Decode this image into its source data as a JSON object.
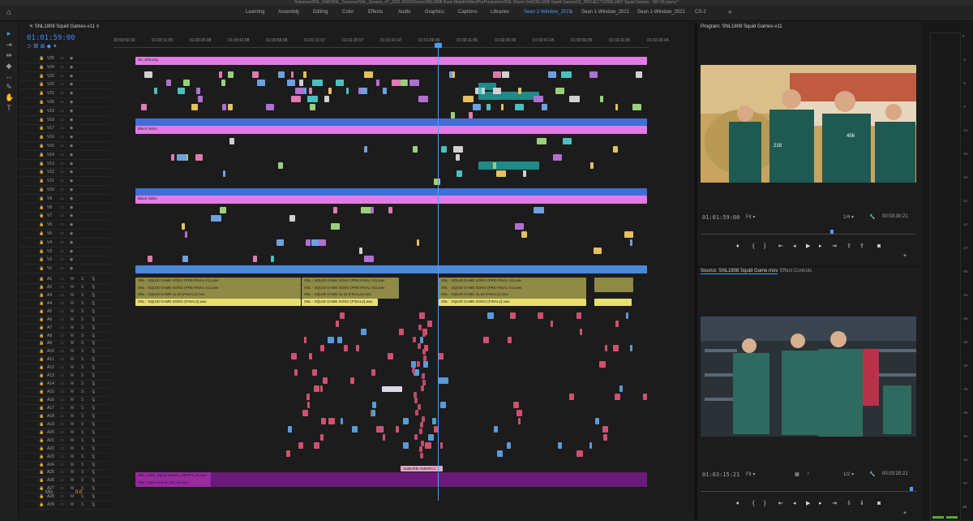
{
  "titlebar": "/Volumes/SNL_SAN/SNL_Seasons/SNL_Season_47_2021-2022/Shows/SNL1808 Rami Malek/Video/PreProduction/SNL Shoot Unit/SNL1808 Squid Games/01_PROJECTS/SNL1807 Squid Games - SM V6.prproj *",
  "workspaces": [
    "Learning",
    "Assembly",
    "Editing",
    "Color",
    "Effects",
    "Audio",
    "Graphics",
    "Captions",
    "Libraries",
    "Sean 2-Window_2021",
    "Sean 1-Window_2021",
    "Sean 1-Window_2021",
    "CS-2"
  ],
  "workspace_active": "Sean 2-Window_2021",
  "sequence": {
    "name": "SNL1808 Squid Games-v11",
    "timecode": "01:01:59:00"
  },
  "ruler": [
    "00:59:56:09",
    "01:00:11:09",
    "01:00:26:08",
    "01:00:41:08",
    "01:00:56:08",
    "01:01:11:07",
    "01:01:26:07",
    "01:01:41:07",
    "01:01:56:06",
    "01:02:11:06",
    "01:02:26:06",
    "01:02:41:05",
    "01:02:56:05",
    "01:03:11:05",
    "01:03:26:04"
  ],
  "video_tracks": [
    "V25",
    "V24",
    "V23",
    "V22",
    "V21",
    "V20",
    "V19",
    "V18",
    "V17",
    "V16",
    "V15",
    "V14",
    "V13",
    "V12",
    "V11",
    "V10",
    "V9",
    "V8",
    "V7",
    "V6",
    "V5",
    "V4",
    "V3",
    "V2",
    "V1"
  ],
  "audio_tracks": [
    "A1",
    "A2",
    "A3",
    "A4",
    "A5",
    "A6",
    "A7",
    "A8",
    "A9",
    "A10",
    "A11",
    "A12",
    "A13",
    "A14",
    "A15",
    "A16",
    "A17",
    "A18",
    "A19",
    "A20",
    "A21",
    "A22",
    "A23",
    "A24",
    "A25",
    "A26",
    "A27",
    "A28",
    "A29"
  ],
  "clip_labels": {
    "png": "SK_008.png",
    "black1": "Black Video",
    "black2": "Black Video",
    "audio1": "SNL - SQUID GAME SONG (PRE-FINAL V1).wav",
    "audio2": "SNL - SQUID GAME SONG (FINAL2).wav",
    "audio3": "SNL - SQUID GAME 11.16 (FINAL2).mov",
    "sub": "SUBURB-AMERICA",
    "a28": "SNL_1808_Squid Games_DRAFT_v3.wav",
    "a29": "SNL_Squid Game_SM_v2.wav"
  },
  "mix_label": "Mix",
  "mix_value": "0.0",
  "program": {
    "title": "Program: SNL1808 Squid Games-v11",
    "timecode": "01:01:59:00",
    "fit": "Fit",
    "ratio": "1/4",
    "duration": "00:03:30:21",
    "numbers": [
      "218",
      "456"
    ]
  },
  "source": {
    "title": "Source: SNL1808 Squid Game.mov",
    "tab2": "Effect Controls",
    "timecode": "01:03:15:21",
    "fit": "Fit",
    "ratio": "1/2",
    "duration": "00:03:20:21"
  },
  "meter_ticks": [
    "0",
    "-3",
    "-6",
    "-9",
    "-12",
    "-15",
    "-18",
    "-21",
    "-24",
    "-27",
    "-30",
    "-33",
    "-36",
    "-39",
    "-42",
    "-45",
    "-48",
    "-51",
    "-54",
    "-57",
    "dB"
  ]
}
